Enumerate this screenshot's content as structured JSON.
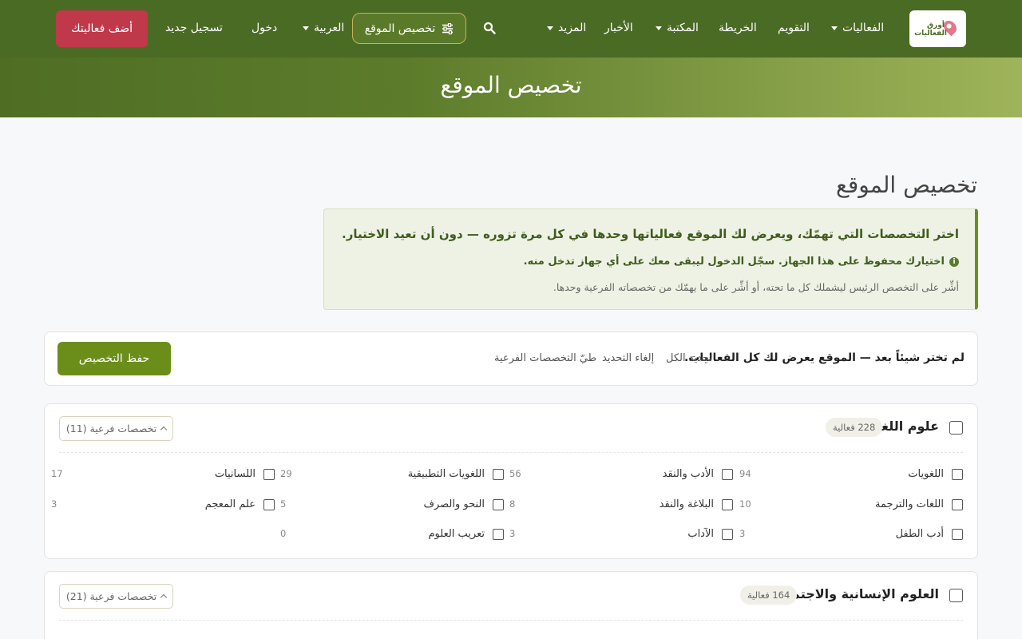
{
  "nav": {
    "logo_text": "أورق الفعاليات",
    "events": "الفعاليات",
    "calendar": "التقويم",
    "map": "الخريطة",
    "library": "المكتبة",
    "news": "الأخبار",
    "more": "المزيد",
    "customize": "تخصيص الموقع",
    "language": "العربية",
    "login": "دخول",
    "register": "تسجيل جديد",
    "add_event": "أضف فعاليتك"
  },
  "hero": {
    "title": "تخصيص الموقع"
  },
  "page": {
    "title": "تخصيص الموقع"
  },
  "info": {
    "line1": "اختر التخصصات التي تهمّك، ويعرض لك الموقع فعالياتها وحدها في كل مرة تزوره — دون أن تعيد الاختيار.",
    "line2": "اختيارك محفوظ على هذا الجهاز. سجّل الدخول ليبقى معك على أي جهاز تدخل منه.",
    "line3": "أشِّر على التخصص الرئيس ليشملك كل ما تحته، أو أشِّر على ما يهمّك من تخصصاته الفرعية وحدها."
  },
  "toolbar": {
    "status": "لم تختر شيئاً بعد — الموقع يعرض لك كل الفعاليات.",
    "select_all": "تحديد الكل",
    "clear": "إلغاء التحديد",
    "collapse": "طيّ التخصصات الفرعية",
    "save": "حفظ التخصيص"
  },
  "categories": [
    {
      "title": "علوم اللغة",
      "badge": "228 فعالية",
      "toggle": "تخصصات فرعية (11)",
      "subs": [
        {
          "label": "اللغويات",
          "count": "94"
        },
        {
          "label": "الأدب والنقد",
          "count": "56"
        },
        {
          "label": "اللغويات التطبيقية",
          "count": "29"
        },
        {
          "label": "اللسانيات",
          "count": "17"
        },
        {
          "label": "اللغات والترجمة",
          "count": "10"
        },
        {
          "label": "البلاغة والنقد",
          "count": "8"
        },
        {
          "label": "النحو والصرف",
          "count": "5"
        },
        {
          "label": "علم المعجم",
          "count": "3"
        },
        {
          "label": "أدب الطفل",
          "count": "3"
        },
        {
          "label": "الآداب",
          "count": "3"
        },
        {
          "label": "تعريب العلوم",
          "count": "0"
        }
      ]
    },
    {
      "title": "العلوم الإنسانية والاجتماعية",
      "badge": "164 فعالية",
      "toggle": "تخصصات فرعية (21)"
    }
  ],
  "colors": {
    "nav_bg": "#4a6b24",
    "accent": "#6b8e1b",
    "add_btn": "#c0394b"
  }
}
